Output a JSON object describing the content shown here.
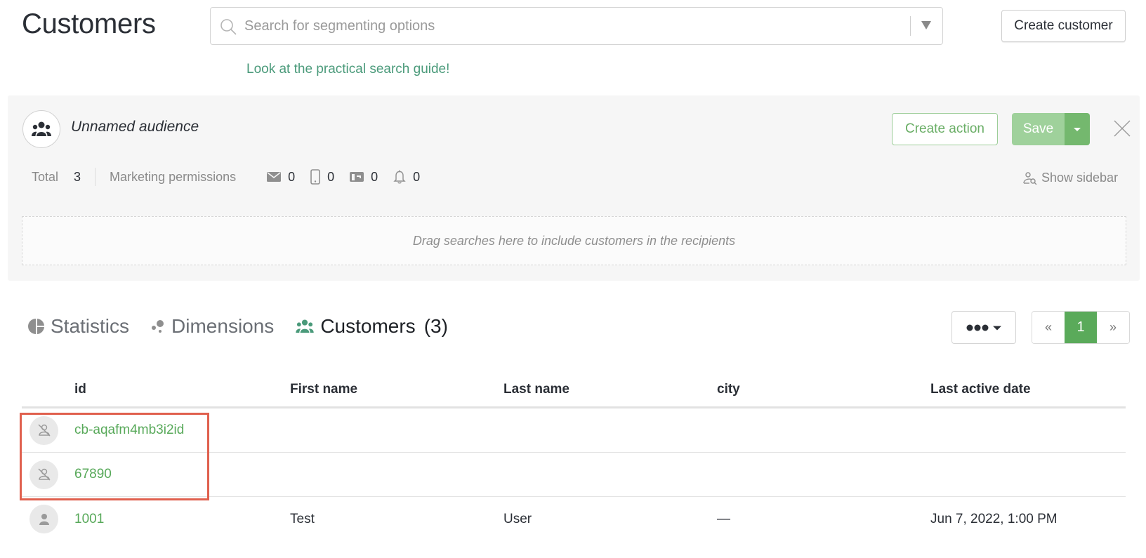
{
  "header": {
    "title": "Customers",
    "search": {
      "placeholder": "Search for segmenting options",
      "value": ""
    },
    "guide_link": "Look at the practical search guide!",
    "create_customer_label": "Create customer"
  },
  "audience": {
    "name": "Unnamed audience",
    "create_action_label": "Create action",
    "save_label": "Save",
    "stats": {
      "total_label": "Total",
      "total_value": "3",
      "permissions_label": "Marketing permissions",
      "permissions": [
        {
          "icon": "email-icon",
          "value": "0"
        },
        {
          "icon": "mobile-icon",
          "value": "0"
        },
        {
          "icon": "mailbox-icon",
          "value": "0"
        },
        {
          "icon": "bell-icon",
          "value": "0"
        }
      ]
    },
    "show_sidebar_label": "Show sidebar",
    "drop_zone_text": "Drag searches here to include customers in the recipients"
  },
  "tabs": [
    {
      "label": "Statistics",
      "icon": "pie-chart-icon",
      "active": false
    },
    {
      "label": "Dimensions",
      "icon": "dimensions-icon",
      "active": false
    },
    {
      "label": "Customers",
      "icon": "users-icon",
      "active": true,
      "count": "(3)"
    }
  ],
  "pagination": {
    "prev": "«",
    "current": "1",
    "next": "»"
  },
  "colors": {
    "accent": "#5aaa5a",
    "link": "#58a95a",
    "highlight": "#e0604e"
  },
  "table": {
    "columns": [
      "id",
      "First name",
      "Last name",
      "city",
      "Last active date"
    ],
    "rows": [
      {
        "avatar": "anonymous-user-icon",
        "id": "cb-aqafm4mb3i2id",
        "first_name": "",
        "last_name": "",
        "city": "",
        "last_active": ""
      },
      {
        "avatar": "anonymous-user-icon",
        "id": "67890",
        "first_name": "",
        "last_name": "",
        "city": "",
        "last_active": ""
      },
      {
        "avatar": "user-icon",
        "id": "1001",
        "first_name": "Test",
        "last_name": "User",
        "city": "—",
        "last_active": "Jun 7, 2022, 1:00 PM"
      }
    ]
  }
}
